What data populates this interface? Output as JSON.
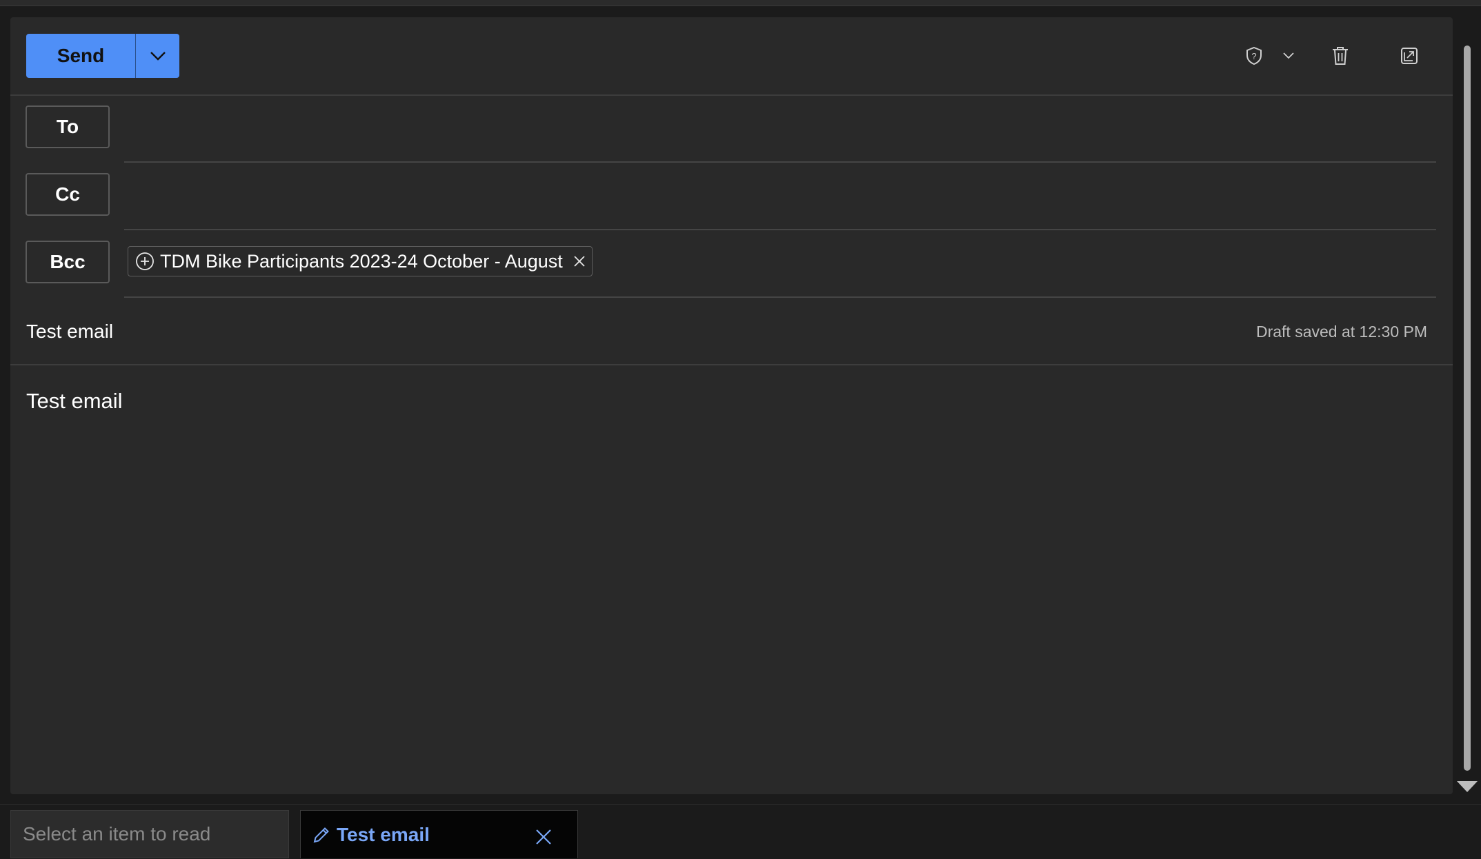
{
  "toolbar": {
    "send_label": "Send",
    "send_dropdown_icon": "chevron-down-icon",
    "sensitivity_icon": "shield-question-icon",
    "sensitivity_dropdown_icon": "chevron-down-icon",
    "discard_icon": "trash-icon",
    "popout_icon": "open-in-new-window-icon"
  },
  "recipients": {
    "to_label": "To",
    "cc_label": "Cc",
    "bcc_label": "Bcc",
    "bcc_chips": [
      {
        "label": "TDM Bike Participants 2023-24 October - August",
        "expand_icon": "plus-circle-icon",
        "remove_icon": "close-icon"
      }
    ]
  },
  "subject": "Test email",
  "draft_status": "Draft saved at 12:30 PM",
  "body": "Test email",
  "bottom_tabs": {
    "read_placeholder": "Select an item to read",
    "draft_tab_label": "Test email",
    "draft_tab_icon": "pencil-icon",
    "draft_tab_close_icon": "close-icon"
  },
  "colors": {
    "accent": "#4f8ff7",
    "background": "#1b1b1b",
    "panel": "#292929",
    "tab_text_accent": "#7aa7f7"
  }
}
